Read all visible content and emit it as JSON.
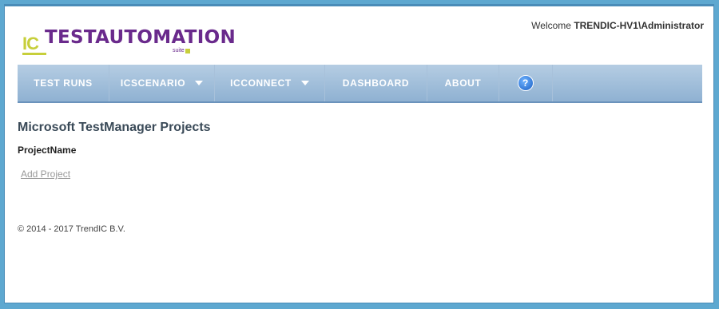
{
  "brand": {
    "logo_prefix": "IC",
    "logo_name": "TESTAUTOMATION",
    "logo_suffix": "suite"
  },
  "header": {
    "welcome_prefix": "Welcome",
    "username": "TRENDIC-HV1\\Administrator"
  },
  "nav": {
    "items": [
      {
        "label": "TEST RUNS"
      },
      {
        "label": "ICSCENARIO"
      },
      {
        "label": "ICCONNECT"
      },
      {
        "label": "DASHBOARD"
      },
      {
        "label": "ABOUT"
      },
      {
        "label": "?"
      }
    ]
  },
  "main": {
    "title": "Microsoft TestManager Projects",
    "column_header": "ProjectName",
    "add_link": "Add Project"
  },
  "footer": {
    "copyright": "© 2014 - 2017 TrendIC B.V."
  }
}
